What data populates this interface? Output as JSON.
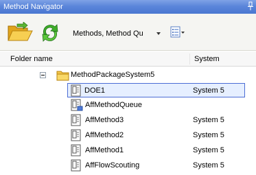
{
  "window": {
    "title": "Method Navigator"
  },
  "toolbar": {
    "view_selector_value": "Methods, Method Qu",
    "icons": [
      "folder-open-icon",
      "refresh-icon",
      "list-view-icon"
    ]
  },
  "columns": {
    "folder_name": "Folder name",
    "system": "System"
  },
  "tree": {
    "folder": {
      "label": "MethodPackageSystem5",
      "expanded": true
    },
    "items": [
      {
        "label": "DOE1",
        "system": "System 5",
        "icon": "method-icon",
        "selected": true
      },
      {
        "label": "AffMethodQueue",
        "system": "",
        "icon": "method-queue-icon",
        "selected": false
      },
      {
        "label": "AffMethod3",
        "system": "System 5",
        "icon": "method-icon",
        "selected": false
      },
      {
        "label": "AffMethod2",
        "system": "System 5",
        "icon": "method-icon",
        "selected": false
      },
      {
        "label": "AffMethod1",
        "system": "System 5",
        "icon": "method-icon",
        "selected": false
      },
      {
        "label": "AffFlowScouting",
        "system": "System 5",
        "icon": "method-icon",
        "selected": false
      }
    ]
  },
  "colors": {
    "titlebar": "#5b86da",
    "selection_border": "#4a6cd4",
    "selection_fill": "#e6efff"
  }
}
